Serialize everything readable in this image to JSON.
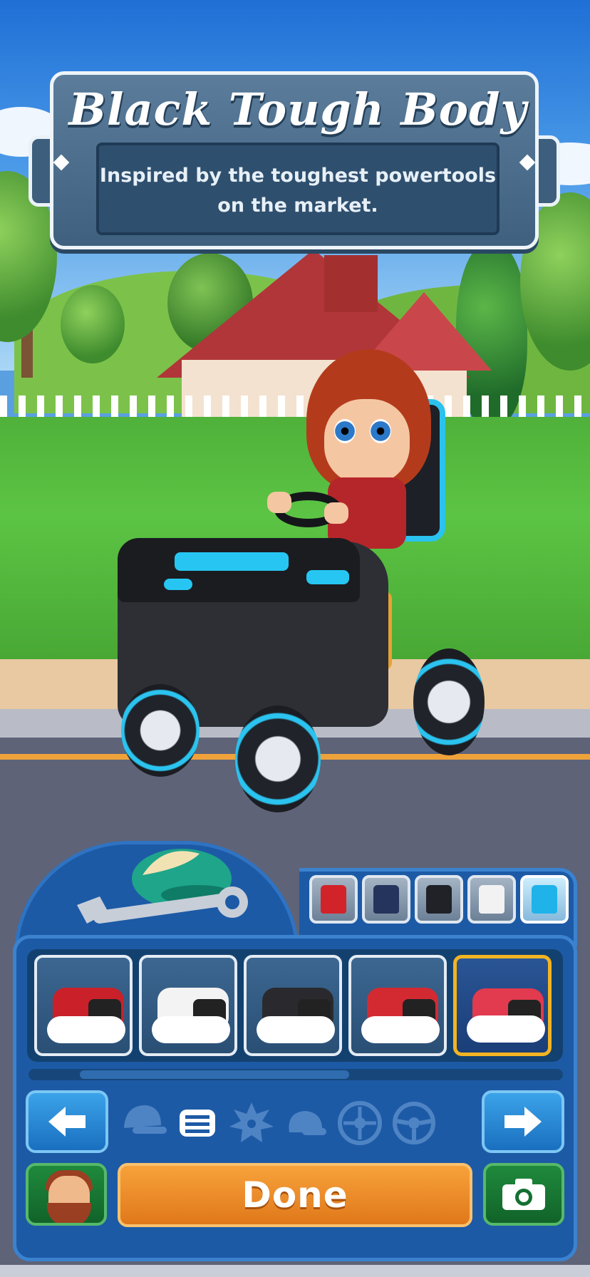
{
  "item": {
    "title": "Black Tough Body",
    "description_line1": "Inspired by the toughest powertools",
    "description_line2": "on the market."
  },
  "color_swatches": [
    {
      "name": "red",
      "color": "#d3232a",
      "selected": false
    },
    {
      "name": "navy-red",
      "color": "#24345c",
      "selected": false
    },
    {
      "name": "black",
      "color": "#202228",
      "selected": false
    },
    {
      "name": "white-orange",
      "color": "#f2f2f2",
      "selected": false
    },
    {
      "name": "cyan",
      "color": "#1fb3ea",
      "selected": true
    }
  ],
  "body_options": [
    {
      "name": "body-red-grille",
      "color": "#c9202a",
      "selected": false
    },
    {
      "name": "body-white-black",
      "color": "#f3f3f3",
      "selected": false
    },
    {
      "name": "body-black-red",
      "color": "#2a2a2e",
      "selected": false
    },
    {
      "name": "body-red-square",
      "color": "#d32a32",
      "selected": false
    },
    {
      "name": "body-pink-sport",
      "color": "#e23a4e",
      "selected": true
    }
  ],
  "categories": [
    {
      "name": "cap-icon",
      "active": false
    },
    {
      "name": "body-icon",
      "active": true
    },
    {
      "name": "blade-icon",
      "active": false
    },
    {
      "name": "seat-icon",
      "active": false
    },
    {
      "name": "wheel-icon",
      "active": false
    },
    {
      "name": "steering-wheel-icon",
      "active": false
    }
  ],
  "buttons": {
    "prev_arrow": "🡐",
    "next_arrow": "🡒",
    "done_label": "Done"
  },
  "colors": {
    "panel": "#1d5aa6",
    "selected_border": "#f2b422",
    "done": "#f08a2a",
    "green_button": "#1a7a35"
  },
  "scroll": {
    "position_fraction": 0.1,
    "visible_fraction": 0.5
  }
}
